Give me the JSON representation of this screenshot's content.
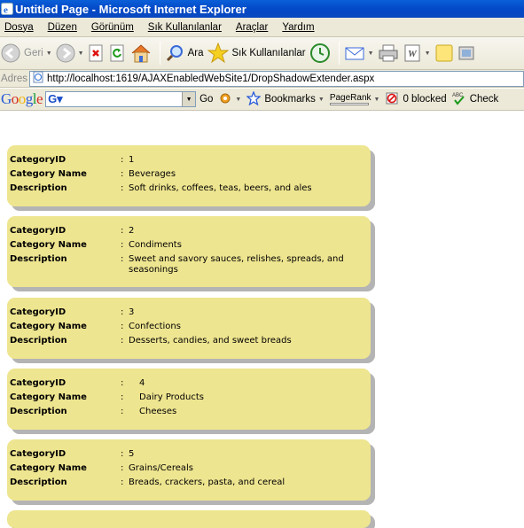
{
  "window": {
    "title": "Untitled Page - Microsoft Internet Explorer"
  },
  "menu": [
    "Dosya",
    "Düzen",
    "Görünüm",
    "Sık Kullanılanlar",
    "Araçlar",
    "Yardım"
  ],
  "toolbar": {
    "back_label": "Geri",
    "search_label": "Ara",
    "favorites_label": "Sık Kullanılanlar"
  },
  "address": {
    "label": "Adres",
    "url": "http://localhost:1619/AJAXEnabledWebSite1/DropShadowExtender.aspx"
  },
  "google": {
    "logo": "Google",
    "go_label": "Go",
    "bookmarks_label": "Bookmarks",
    "pagerank_label": "PageRank",
    "blocked_label": "0 blocked",
    "check_label": "Check"
  },
  "field_labels": {
    "id": "CategoryID",
    "name": "Category Name",
    "description": "Description",
    "separator": ":"
  },
  "categories": [
    {
      "id": "1",
      "name": "Beverages",
      "description": "Soft drinks, coffees, teas, beers, and ales"
    },
    {
      "id": "2",
      "name": "Condiments",
      "description": "Sweet and savory sauces, relishes, spreads, and seasonings"
    },
    {
      "id": "3",
      "name": "Confections",
      "description": "Desserts, candies, and sweet breads"
    },
    {
      "id": "4",
      "name": "Dairy Products",
      "description": "Cheeses"
    },
    {
      "id": "5",
      "name": "Grains/Cereals",
      "description": "Breads, crackers, pasta, and cereal"
    }
  ]
}
